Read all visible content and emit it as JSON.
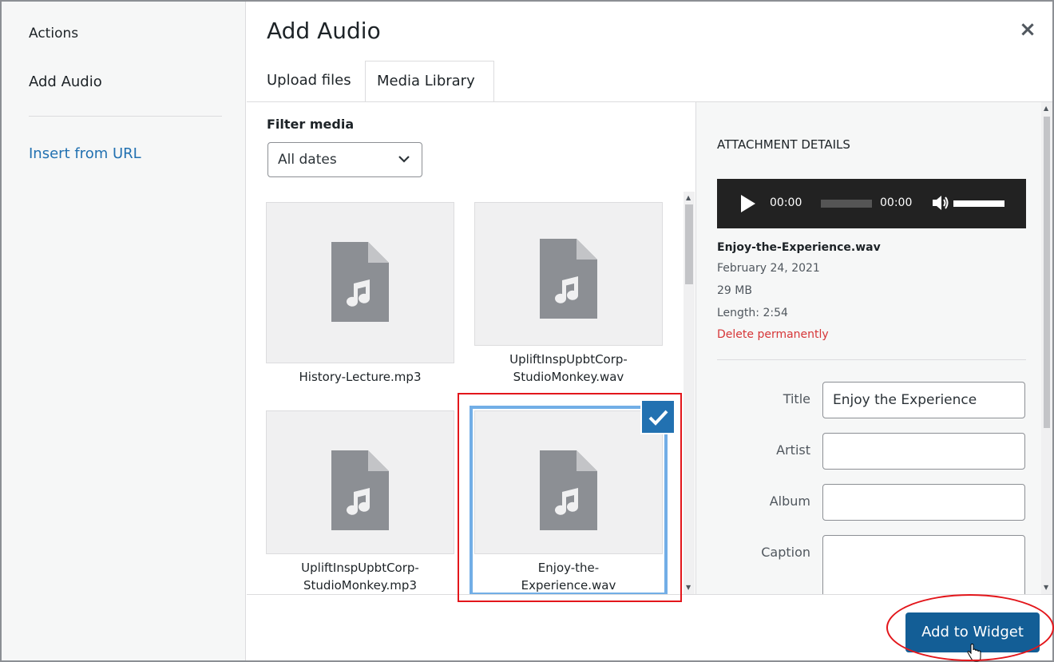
{
  "menu": {
    "actions": "Actions",
    "add_audio": "Add Audio",
    "insert_from_url": "Insert from URL"
  },
  "title": "Add Audio",
  "close_glyph": "×",
  "tabs": {
    "upload": "Upload files",
    "library": "Media Library"
  },
  "filter": {
    "label": "Filter media",
    "dates_value": "All dates",
    "chevron": "⌄"
  },
  "media": [
    {
      "name": "History-Lecture.mp3",
      "selected": false
    },
    {
      "name": "UpliftInspUpbtCorp-StudioMonkey.wav",
      "selected": false
    },
    {
      "name": "UpliftInspUpbtCorp-StudioMonkey.mp3",
      "selected": false
    },
    {
      "name": "Enjoy-the-Experience.wav",
      "selected": true
    }
  ],
  "details": {
    "heading": "Attachment Details",
    "player_time_current": "00:00",
    "player_time_total": "00:00",
    "volume_glyph": "🔊",
    "filename": "Enjoy-the-Experience.wav",
    "date": "February 24, 2021",
    "size": "29 MB",
    "length": "Length: 2:54",
    "delete": "Delete permanently",
    "fields": {
      "title_label": "Title",
      "title_value": "Enjoy the Experience",
      "artist_label": "Artist",
      "artist_value": "",
      "album_label": "Album",
      "album_value": "",
      "caption_label": "Caption",
      "caption_value": ""
    }
  },
  "toolbar": {
    "add_button": "Add to Widget"
  },
  "colors": {
    "accent": "#2271b1",
    "button": "#135e96",
    "danger": "#d63638",
    "annotation": "#e3161b"
  },
  "icons": {
    "audio_file": "audio-file-icon",
    "check": "checkmark-icon",
    "play": "play-icon",
    "volume": "volume-icon",
    "close": "close-icon",
    "cursor": "hand-pointer-icon"
  }
}
